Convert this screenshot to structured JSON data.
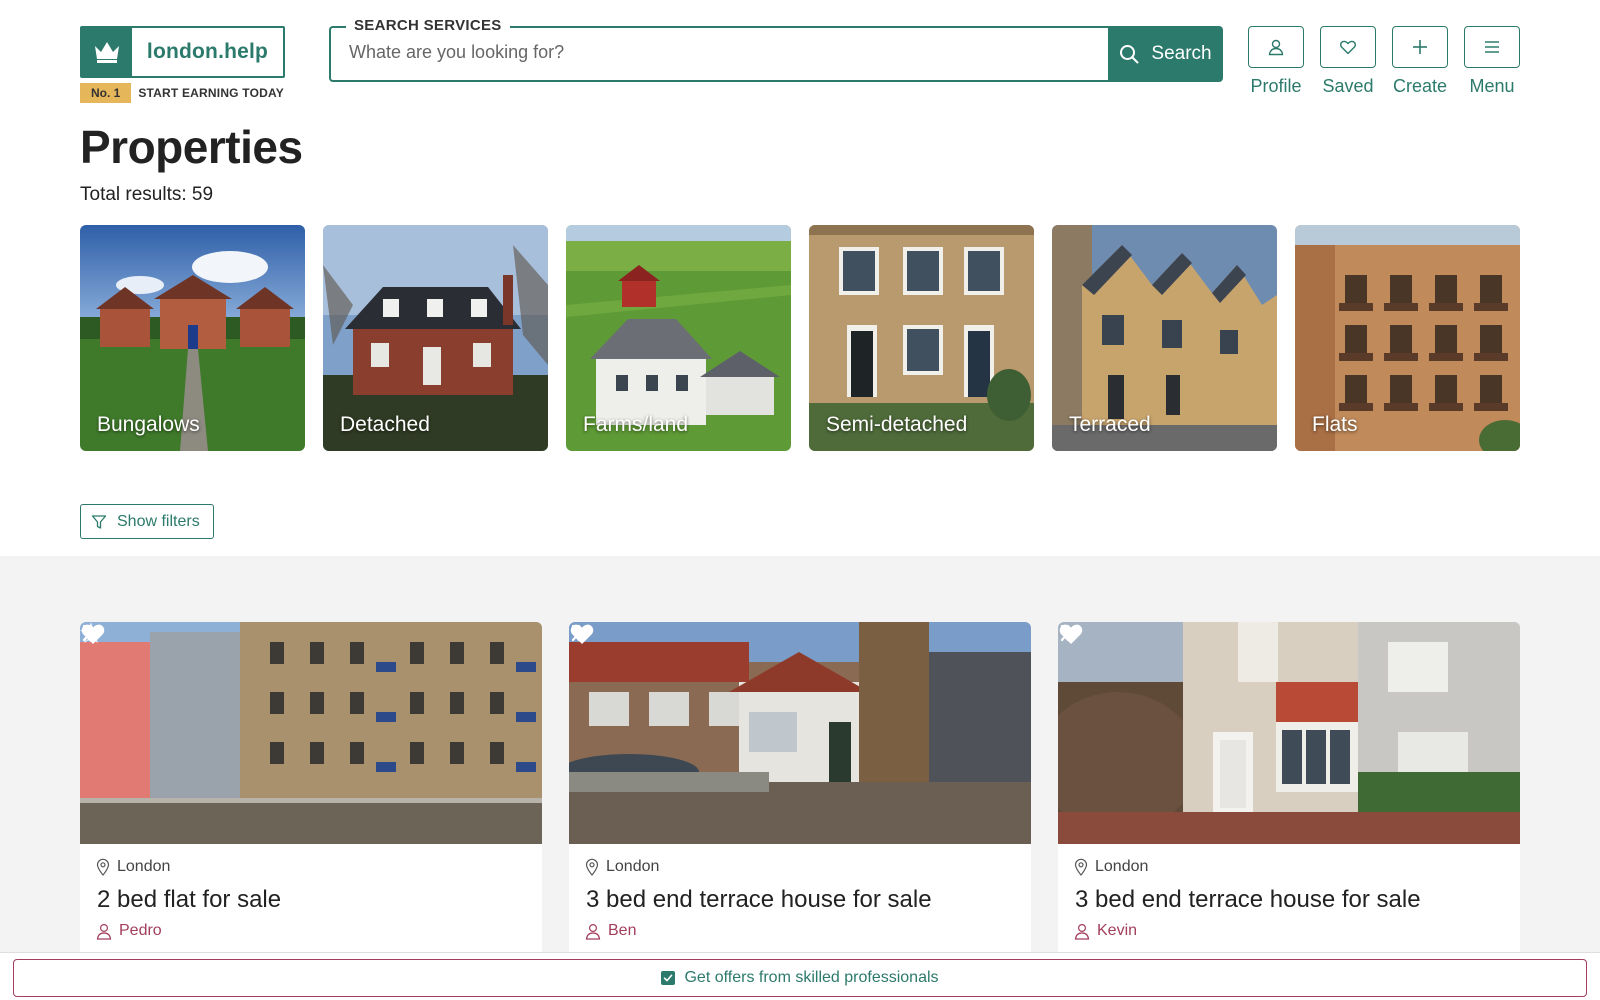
{
  "brand": {
    "name": "london.help",
    "badge": "No. 1",
    "tagline": "START EARNING TODAY",
    "color": "#2c7a6b",
    "accent": "#a23e5c"
  },
  "search": {
    "legend": "SEARCH SERVICES",
    "placeholder": "Whate are you looking for?",
    "button_label": "Search"
  },
  "actions": [
    {
      "label": "Profile",
      "icon": "user-icon"
    },
    {
      "label": "Saved",
      "icon": "heart-icon"
    },
    {
      "label": "Create",
      "icon": "plus-icon"
    },
    {
      "label": "Menu",
      "icon": "menu-icon"
    }
  ],
  "page": {
    "title": "Properties",
    "total": "Total results: 59"
  },
  "categories": [
    {
      "label": "Bungalows"
    },
    {
      "label": "Detached"
    },
    {
      "label": "Farms/land"
    },
    {
      "label": "Semi-detached"
    },
    {
      "label": "Terraced"
    },
    {
      "label": "Flats"
    }
  ],
  "filters": {
    "label": "Show filters"
  },
  "listings": [
    {
      "location": "London",
      "title": "2 bed flat for sale",
      "user": "Pedro"
    },
    {
      "location": "London",
      "title": "3 bed end terrace house for sale",
      "user": "Ben"
    },
    {
      "location": "London",
      "title": "3 bed end terrace house for sale",
      "user": "Kevin"
    }
  ],
  "footer": {
    "offers_label": "Get offers from skilled professionals",
    "offers_checked": true
  }
}
